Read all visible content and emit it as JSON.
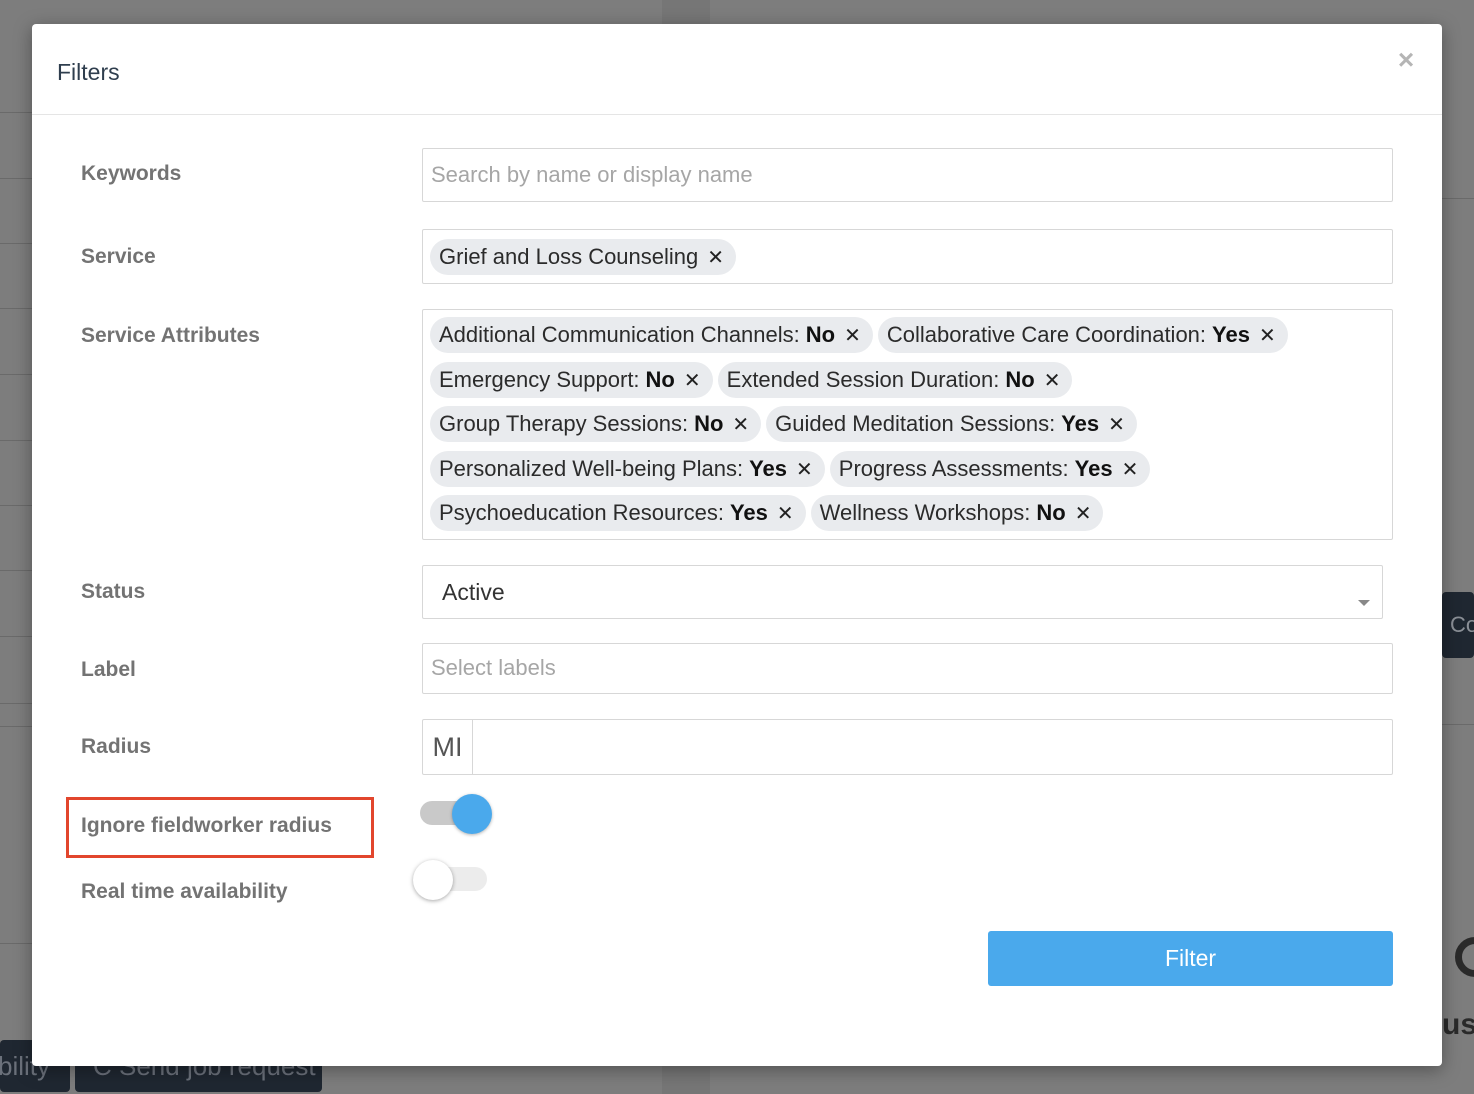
{
  "background": {
    "left_buttons": [
      "bility",
      "C Send job request"
    ],
    "right_button_text": "Co",
    "right_text": "uss"
  },
  "modal": {
    "title": "Filters",
    "close_icon": "close-icon",
    "fields": {
      "keywords": {
        "label": "Keywords",
        "placeholder": "Search by name or display name",
        "value": ""
      },
      "service": {
        "label": "Service",
        "tags": [
          {
            "text": "Grief and Loss Counseling"
          }
        ]
      },
      "service_attributes": {
        "label": "Service Attributes",
        "tags": [
          {
            "name": "Additional Communication Channels:",
            "value": "No"
          },
          {
            "name": "Collaborative Care Coordination:",
            "value": "Yes"
          },
          {
            "name": "Emergency Support:",
            "value": "No"
          },
          {
            "name": "Extended Session Duration:",
            "value": "No"
          },
          {
            "name": "Group Therapy Sessions:",
            "value": "No"
          },
          {
            "name": "Guided Meditation Sessions:",
            "value": "Yes"
          },
          {
            "name": "Personalized Well-being Plans:",
            "value": "Yes"
          },
          {
            "name": "Progress Assessments:",
            "value": "Yes"
          },
          {
            "name": "Psychoeducation Resources:",
            "value": "Yes"
          },
          {
            "name": "Wellness Workshops:",
            "value": "No"
          }
        ]
      },
      "status": {
        "label": "Status",
        "value": "Active"
      },
      "label": {
        "label": "Label",
        "placeholder": "Select labels"
      },
      "radius": {
        "label": "Radius",
        "unit": "MI",
        "value": ""
      },
      "ignore_fieldworker_radius": {
        "label": "Ignore fieldworker radius",
        "on": true
      },
      "real_time_availability": {
        "label": "Real time availability",
        "on": false
      }
    },
    "filter_button": "Filter"
  },
  "colors": {
    "accent": "#4aa9ec",
    "highlight": "#e2462d",
    "label": "#737373",
    "tag_bg": "#e9ebee"
  }
}
